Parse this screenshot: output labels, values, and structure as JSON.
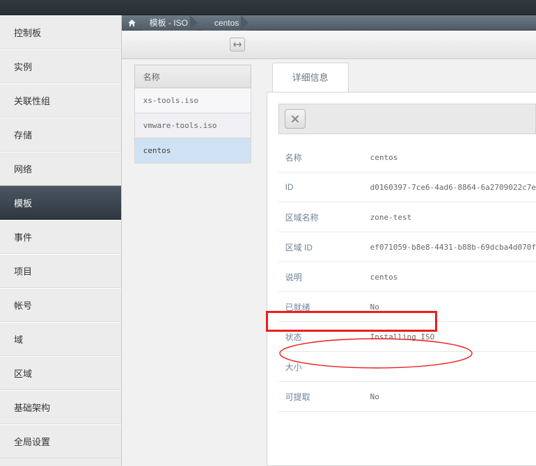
{
  "sidebar": {
    "items": [
      {
        "label": "控制板"
      },
      {
        "label": "实例"
      },
      {
        "label": "关联性组"
      },
      {
        "label": "存储"
      },
      {
        "label": "网络"
      },
      {
        "label": "模板"
      },
      {
        "label": "事件"
      },
      {
        "label": "项目"
      },
      {
        "label": "帐号"
      },
      {
        "label": "域"
      },
      {
        "label": "区域"
      },
      {
        "label": "基础架构"
      },
      {
        "label": "全局设置"
      }
    ],
    "active_index": 5
  },
  "breadcrumb": {
    "seg1": "模板 - ISO",
    "seg2": "centos"
  },
  "list": {
    "header": "名称",
    "rows": [
      {
        "label": "xs-tools.iso"
      },
      {
        "label": "vmware-tools.iso"
      },
      {
        "label": "centos"
      }
    ],
    "selected_index": 2
  },
  "detail": {
    "tab_label": "详细信息",
    "fields": {
      "name_label": "名称",
      "name_value": "centos",
      "id_label": "ID",
      "id_value": "d0160397-7ce6-4ad6-8864-6a2709022c7e",
      "zone_label": "区域名称",
      "zone_value": "zone-test",
      "zoneid_label": "区域 ID",
      "zoneid_value": "ef071059-b8e8-4431-b88b-69dcba4d070f",
      "desc_label": "说明",
      "desc_value": "centos",
      "ready_label": "已就绪",
      "ready_value": "No",
      "status_label": "状态",
      "status_value": "Installing ISO",
      "size_label": "大小",
      "size_value": "",
      "extract_label": "可提取",
      "extract_value": "No"
    }
  }
}
